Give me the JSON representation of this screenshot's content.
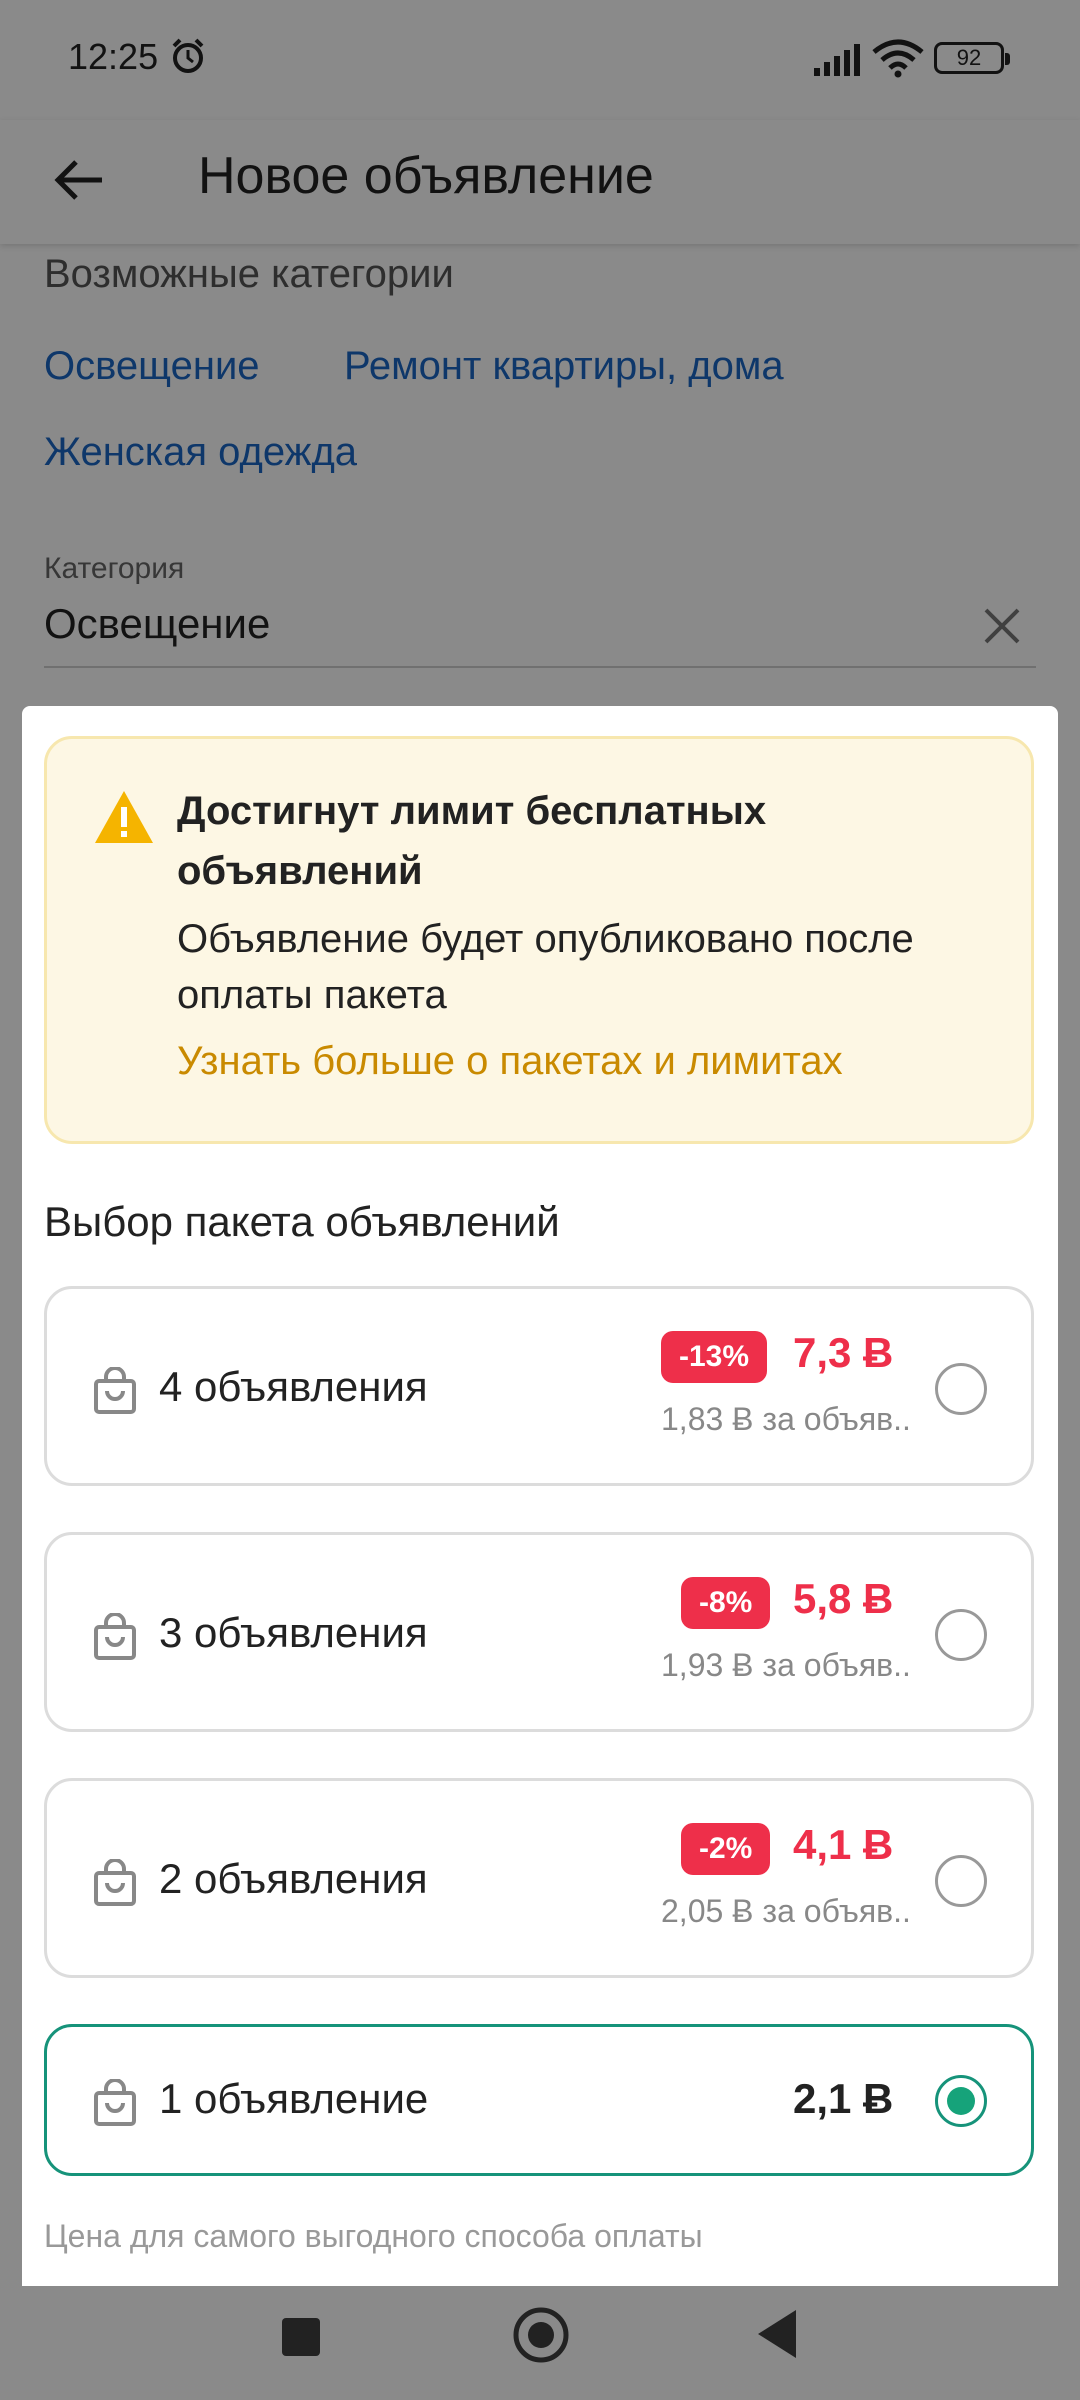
{
  "status": {
    "time": "12:25",
    "battery": "92"
  },
  "appbar": {
    "title": "Новое объявление"
  },
  "categories": {
    "label": "Возможные категории",
    "links": [
      "Освещение",
      "Ремонт квартиры, дома",
      "Женская одежда"
    ]
  },
  "category_field": {
    "label": "Категория",
    "value": "Освещение"
  },
  "warning": {
    "title": "Достигнут лимит бесплатных объявлений",
    "text": "Объявление будет опубликовано после оплаты пакета",
    "link": "Узнать больше о пакетах и лимитах"
  },
  "packages": {
    "title": "Выбор пакета объявлений",
    "items": [
      {
        "name": "4 объявления",
        "discount": "-13%",
        "price": "7,3 Ƀ",
        "per_ad": "1,83 Ƀ за объяв..",
        "selected": false
      },
      {
        "name": "3 объявления",
        "discount": "-8%",
        "price": "5,8 Ƀ",
        "per_ad": "1,93 Ƀ за объяв..",
        "selected": false
      },
      {
        "name": "2 объявления",
        "discount": "-2%",
        "price": "4,1 Ƀ",
        "per_ad": "2,05 Ƀ за объяв..",
        "selected": false
      },
      {
        "name": "1 объявление",
        "price": "2,1 Ƀ",
        "selected": true
      }
    ],
    "footnote": "Цена для самого выгодного способа оплаты"
  },
  "colors": {
    "accent_green": "#16937a",
    "discount_red": "#ee2f4a",
    "link_orange": "#c98a00",
    "link_blue": "#1a66c4"
  }
}
